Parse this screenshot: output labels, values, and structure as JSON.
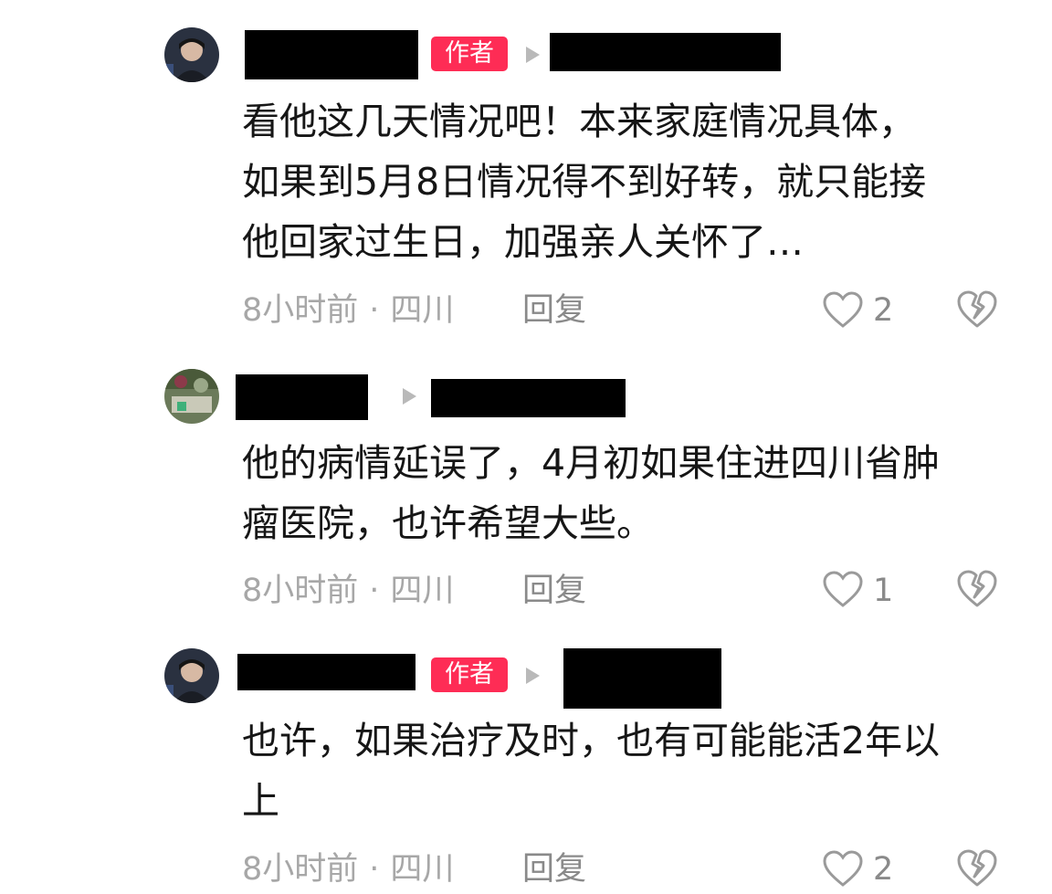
{
  "comments": [
    {
      "badge": "作者",
      "lines": [
        "看他这几天情况吧！本来家庭情况具体，",
        "如果到5月8日情况得不到好转，就只能接",
        "他回家过生日，加强亲人关怀了…"
      ],
      "time": "8小时前",
      "location": "四川",
      "reply": "回复",
      "likes": "2"
    },
    {
      "lines": [
        "他的病情延误了，4月初如果住进四川省肿",
        "瘤医院，也许希望大些。"
      ],
      "time": "8小时前",
      "location": "四川",
      "reply": "回复",
      "likes": "1"
    },
    {
      "badge": "作者",
      "lines": [
        "也许，如果治疗及时，也有可能能活2年以",
        "上"
      ],
      "time": "8小时前",
      "location": "四川",
      "reply": "回复",
      "likes": "2"
    }
  ],
  "meta_separator": "·",
  "colors": {
    "badge": "#fe2c55",
    "text": "#161616",
    "meta": "#a7a7a7"
  },
  "icons": [
    "arrow-right-icon",
    "heart-outline-icon",
    "broken-heart-icon"
  ]
}
